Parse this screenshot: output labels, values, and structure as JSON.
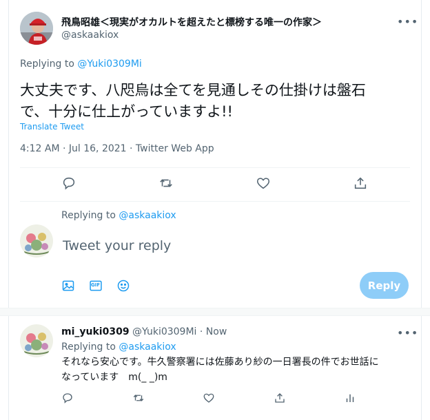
{
  "main_tweet": {
    "display_name": "飛鳥昭雄＜現実がオカルトを超えたと標榜する唯一の作家＞",
    "handle": "@askaakiox",
    "replying_prefix": "Replying to",
    "replying_to": "@Yuki0309Mi",
    "text_line1": "大丈夫です、八咫烏は全てを見通しその仕掛けは盤石",
    "text_line2": "で、十分に仕上がっていますよ!!",
    "translate_label": "Translate Tweet",
    "timestamp": "4:12 AM · Jul 16, 2021 · Twitter Web App"
  },
  "composer": {
    "replying_prefix": "Replying to",
    "replying_to": "@askaakiox",
    "placeholder": "Tweet your reply",
    "reply_label": "Reply",
    "gif_label": "GIF"
  },
  "reply_tweet": {
    "display_name": "mi_yuki0309",
    "handle": "@Yuki0309Mi",
    "time": "· Now",
    "replying_prefix": "Replying to",
    "replying_to": "@askaakiox",
    "text_line1": "それなら安心です。牛久警察署には佐藤あり紗の一日署長の件でお世話に",
    "text_line2": "なっています　m(_ _)m"
  },
  "colors": {
    "accent": "#1d9bf0",
    "muted": "#536471",
    "reply_button_disabled": "#8ecdf8"
  },
  "icons": [
    "reply-icon",
    "retweet-icon",
    "like-icon",
    "share-icon",
    "image-icon",
    "gif-icon",
    "emoji-icon",
    "analytics-icon",
    "more-icon"
  ]
}
